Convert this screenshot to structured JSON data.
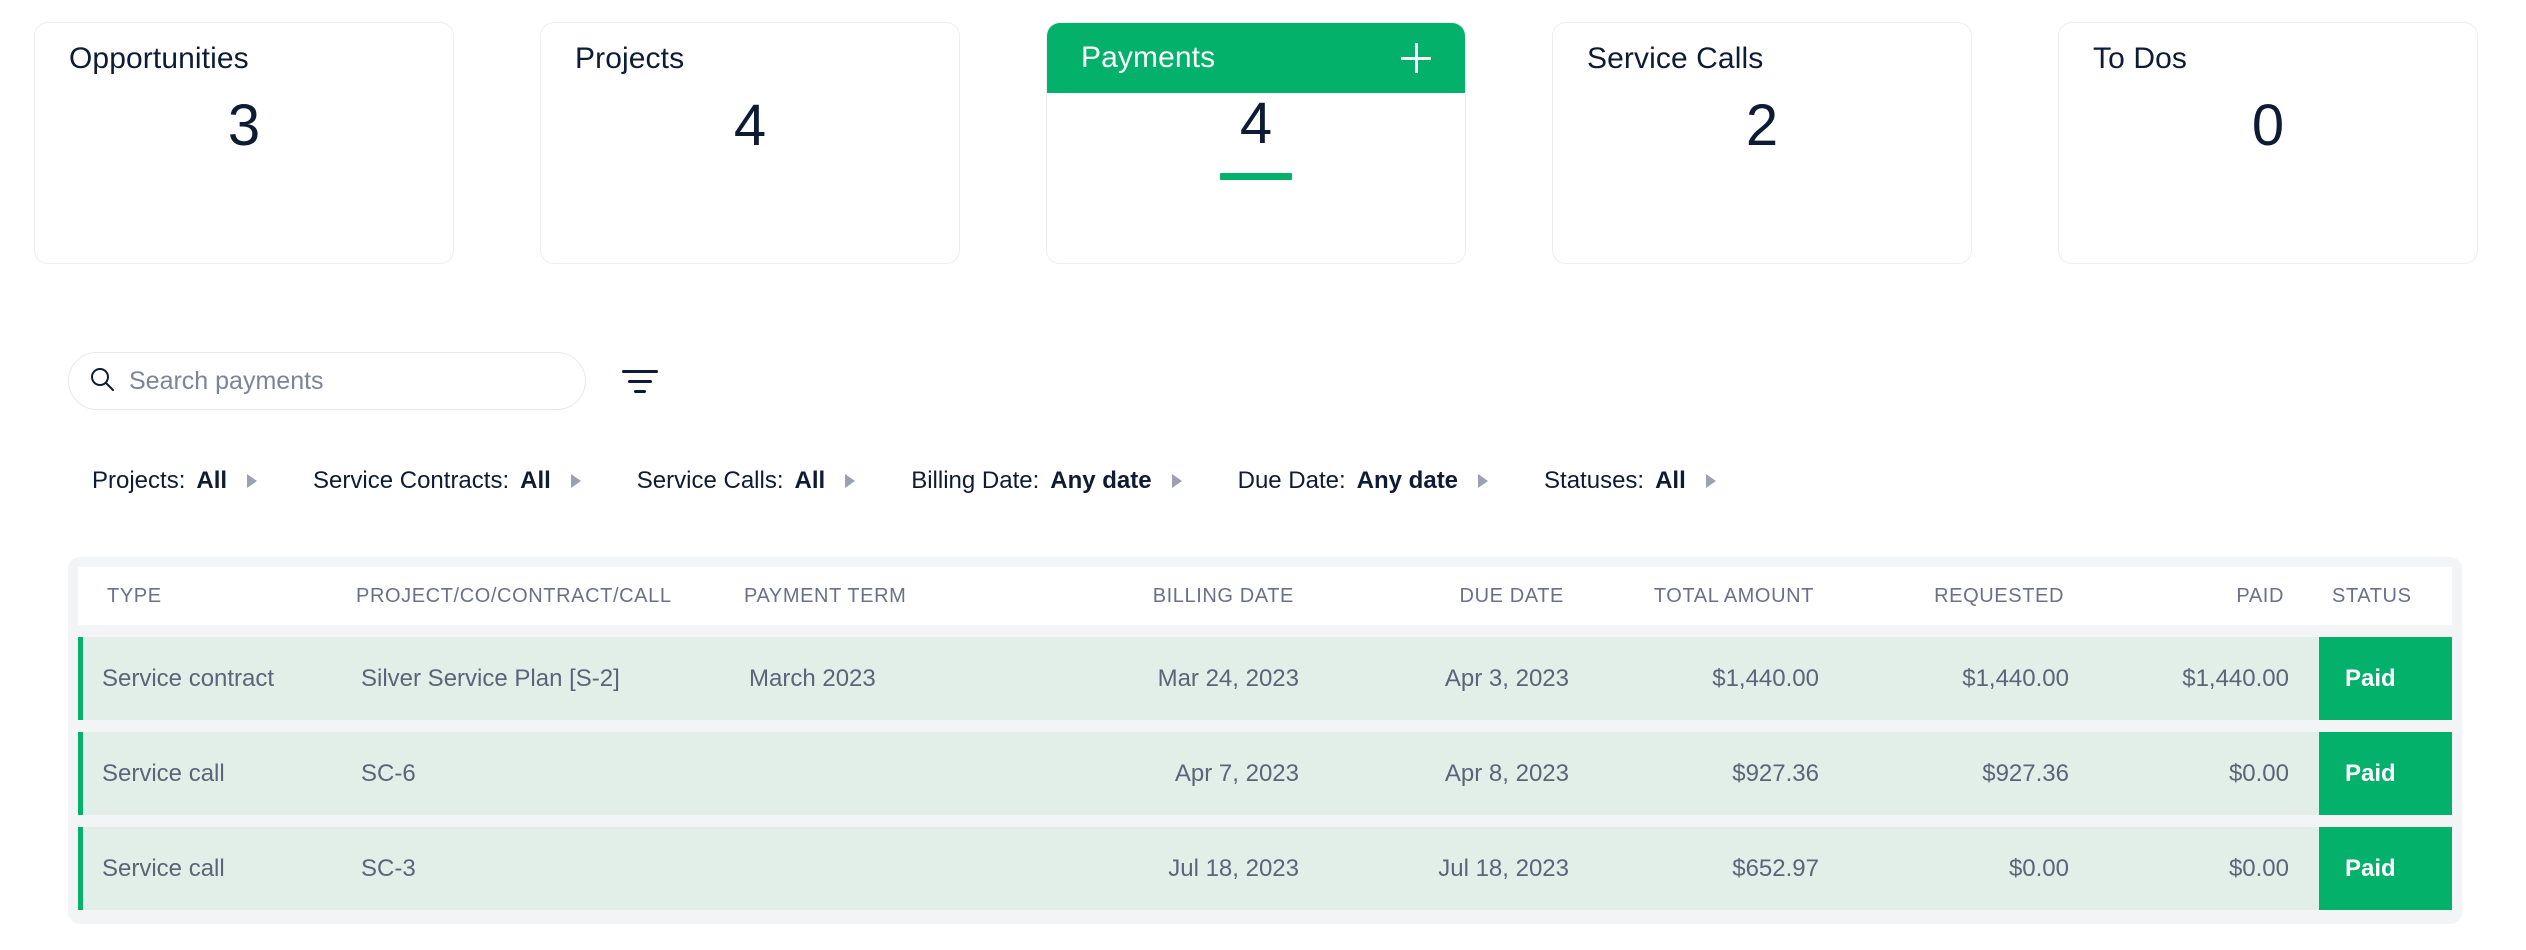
{
  "theme": {
    "accent_green": "#03b16a",
    "row_green": "#e2efe8",
    "dark_navy": "#0d1b35",
    "muted_gray": "#5b6478",
    "panel_gray": "#f2f4f6"
  },
  "summary_cards": [
    {
      "title": "Opportunities",
      "count": "3",
      "active": false
    },
    {
      "title": "Projects",
      "count": "4",
      "active": false
    },
    {
      "title": "Payments",
      "count": "4",
      "active": true,
      "add_icon": "plus-icon"
    },
    {
      "title": "Service Calls",
      "count": "2",
      "active": false
    },
    {
      "title": "To Dos",
      "count": "0",
      "active": false
    }
  ],
  "search": {
    "placeholder": "Search payments",
    "value": "",
    "icon": "search-icon",
    "filter_icon": "filter-icon"
  },
  "filters": [
    {
      "label": "Projects:",
      "value": "All"
    },
    {
      "label": "Service Contracts:",
      "value": "All"
    },
    {
      "label": "Service Calls:",
      "value": "All"
    },
    {
      "label": "Billing Date:",
      "value": "Any date"
    },
    {
      "label": "Due Date:",
      "value": "Any date"
    },
    {
      "label": "Statuses:",
      "value": "All"
    }
  ],
  "table": {
    "columns": [
      "TYPE",
      "PROJECT/CO/CONTRACT/CALL",
      "PAYMENT TERM",
      "BILLING DATE",
      "DUE DATE",
      "TOTAL AMOUNT",
      "REQUESTED",
      "PAID",
      "STATUS"
    ],
    "rows": [
      {
        "type": "Service contract",
        "project": "Silver Service Plan [S-2]",
        "term": "March 2023",
        "billing_date": "Mar 24, 2023",
        "due_date": "Apr 3, 2023",
        "total_amount": "$1,440.00",
        "requested": "$1,440.00",
        "paid": "$1,440.00",
        "status": "Paid"
      },
      {
        "type": "Service call",
        "project": "SC-6",
        "term": "",
        "billing_date": "Apr 7, 2023",
        "due_date": "Apr 8, 2023",
        "total_amount": "$927.36",
        "requested": "$927.36",
        "paid": "$0.00",
        "status": "Paid"
      },
      {
        "type": "Service call",
        "project": "SC-3",
        "term": "",
        "billing_date": "Jul 18, 2023",
        "due_date": "Jul 18, 2023",
        "total_amount": "$652.97",
        "requested": "$0.00",
        "paid": "$0.00",
        "status": "Paid"
      }
    ]
  }
}
